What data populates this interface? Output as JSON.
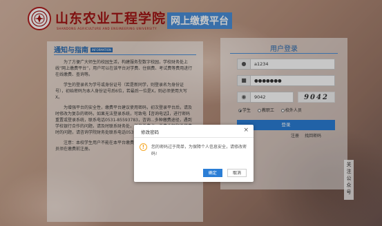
{
  "header": {
    "school_name": "山东农业工程学院",
    "school_name_en": "SHANDONG AGRICULTURE AND ENGINEERING UNIVERSITY",
    "platform_title": "网上缴费平台"
  },
  "notice": {
    "title": "通知与指南",
    "badge": "INFORMATION",
    "paragraphs": [
      "为了方便广大师生的校园生活，构建服务型数字校园，学校财务处上线“网上缴费平台”，用户可以在该平台对学费、住宿费、考试费等费用进行在线缴费、查询等。",
      "学生的登录名为学号或身份证号（若是新同学，则登录名为身份证号），初始密码为本人身份证号后6位，若最后一位是X，则必须使用大写X。",
      "为增强平台的安全性，缴费平台建议使用密码，初次登录平台后，请及时修改为复杂的密码，如果无法登录系统，可致电【咨询电话】，进行密码重置或登录系统，联系电话0531-85593783，咨询...多种缴费途径，遇到学校银行合作的问题，请及时联系财务处，任务缴费点，缴费金额和缴学费时的问题，请咨询学院财务处联系电话0531-85593783。",
      "注意：本校学生用户不能在本平台缴费，外人员缴纳各项费用，校外人员须在缴费前注册。"
    ]
  },
  "login": {
    "title": "用户登录",
    "username": "a1234",
    "password": "●●●●●●●",
    "captcha_input": "9042",
    "captcha_image_text": "9042",
    "roles": [
      "学生",
      "教职工",
      "校外人员"
    ],
    "selected_role": "学生",
    "login_button": "登录",
    "register_link": "注册",
    "forgot_link": "找回密码"
  },
  "side_tab": {
    "label": "关注公众号"
  },
  "modal": {
    "title": "修改密码",
    "close": "×",
    "message": "您的密码过于简单，为保障个人信息安全，请修改密码!",
    "ok_button": "确定",
    "cancel_button": "取消"
  },
  "colors": {
    "brand_red": "#a31515",
    "accent_blue": "#2b7ed6",
    "warning": "#f5a623"
  }
}
